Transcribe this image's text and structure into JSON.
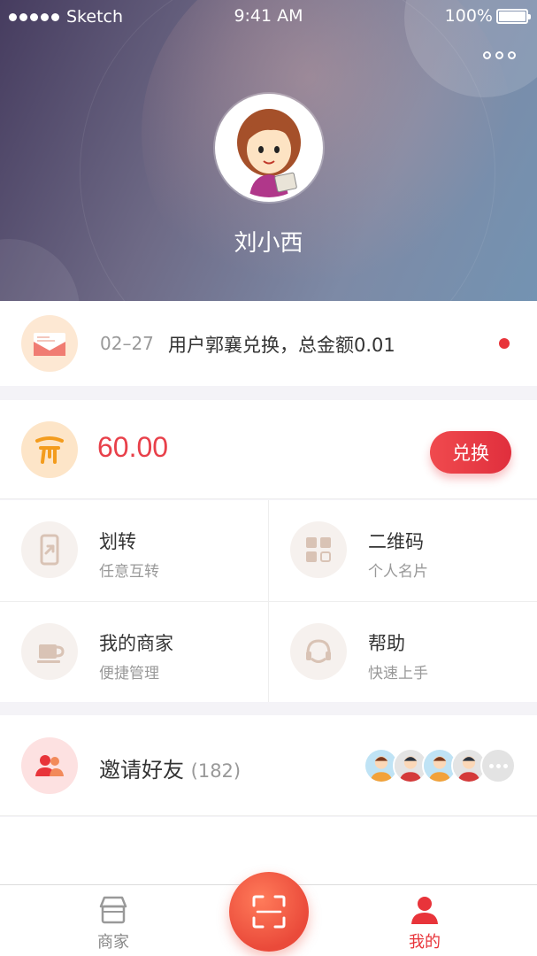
{
  "status_bar": {
    "carrier": "Sketch",
    "time": "9:41 AM",
    "battery": "100%"
  },
  "profile": {
    "name": "刘小西"
  },
  "message": {
    "date": "02–27",
    "text": "用户郭襄兑换，总金额0.01",
    "unread": true
  },
  "balance": {
    "amount": "60.00",
    "exchange_label": "兑换"
  },
  "grid": [
    {
      "title": "划转",
      "subtitle": "任意互转",
      "icon": "phone-transfer-icon"
    },
    {
      "title": "二维码",
      "subtitle": "个人名片",
      "icon": "qrcode-icon"
    },
    {
      "title": "我的商家",
      "subtitle": "便捷管理",
      "icon": "cup-icon"
    },
    {
      "title": "帮助",
      "subtitle": "快速上手",
      "icon": "headset-icon"
    }
  ],
  "invite": {
    "title": "邀请好友",
    "count": "(182)"
  },
  "tabbar": {
    "merchant": "商家",
    "mine": "我的"
  },
  "colors": {
    "accent": "#e8343a",
    "amount": "#e8404a"
  }
}
